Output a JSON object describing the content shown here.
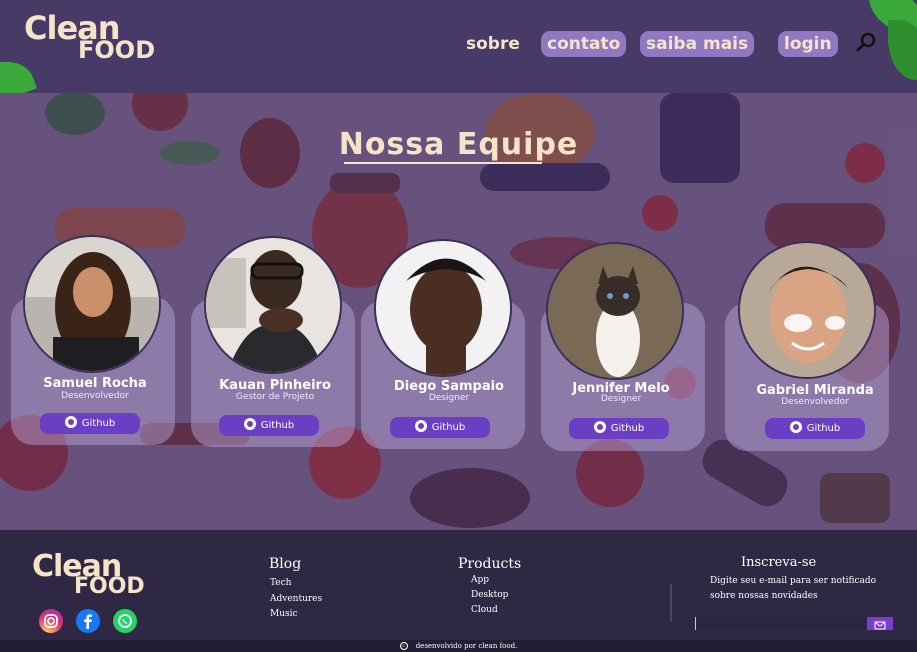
{
  "brand": {
    "line1": "Clean",
    "line2": "FOOD"
  },
  "nav": {
    "sobre": "sobre",
    "contato": "contato",
    "saiba_mais": "saiba mais",
    "login": "login"
  },
  "hero": {
    "title": "Nossa Equipe"
  },
  "team": [
    {
      "name": "Samuel Rocha",
      "role": "Desenvolvedor",
      "github": "Github"
    },
    {
      "name": "Kauan Pinheiro",
      "role": "Gestor de Projeto",
      "github": "Github"
    },
    {
      "name": "Diego Sampaio",
      "role": "Designer",
      "github": "Github"
    },
    {
      "name": "Jennifer Melo",
      "role": "Designer",
      "github": "Github"
    },
    {
      "name": "Gabriel Miranda",
      "role": "Desenvolvedor",
      "github": "Github"
    }
  ],
  "footer": {
    "blog": {
      "title": "Blog",
      "links": [
        "Tech",
        "Adventures",
        "Music"
      ]
    },
    "products": {
      "title": "Products",
      "links": [
        "App",
        "Desktop",
        "Cloud"
      ]
    },
    "newsletter": {
      "title": "Inscreva-se",
      "line1": "Digite seu e-mail para ser notificado",
      "line2": "sobre nossas novidades",
      "placeholder": ""
    },
    "social": [
      "instagram-icon",
      "facebook-icon",
      "whatsapp-icon"
    ],
    "copyright": "desenvolvido por clean food."
  },
  "colors": {
    "header": "#473a66",
    "cream": "#f6e3c8",
    "pill": "#8f79c2",
    "github_button": "#6b3fc4",
    "footer": "#2f2844"
  }
}
